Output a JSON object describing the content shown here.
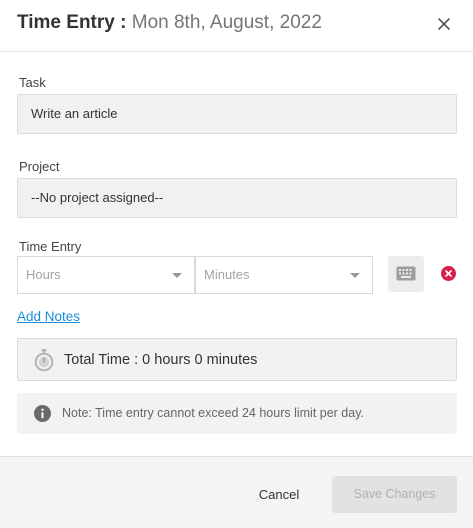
{
  "dialog": {
    "title": "Time Entry :",
    "date": "Mon 8th, August, 2022",
    "close_icon": "close-icon"
  },
  "task": {
    "label": "Task",
    "value": "Write an article"
  },
  "project": {
    "label": "Project",
    "value": "--No project assigned--"
  },
  "time_entry": {
    "label": "Time Entry",
    "hours_placeholder": "Hours",
    "minutes_placeholder": "Minutes",
    "keyboard_icon": "keyboard-icon",
    "remove_icon": "remove-circle-icon"
  },
  "add_notes_label": "Add Notes",
  "total": {
    "icon": "stopwatch-icon",
    "text": "Total Time : 0 hours 0 minutes"
  },
  "note": {
    "icon": "info-icon",
    "text": "Note: Time entry cannot exceed 24 hours limit per day."
  },
  "footer": {
    "cancel_label": "Cancel",
    "save_label": "Save Changes"
  },
  "colors": {
    "link": "#1a8cd8",
    "remove": "#d8204a",
    "disabled_button": "#e2e2e2"
  }
}
